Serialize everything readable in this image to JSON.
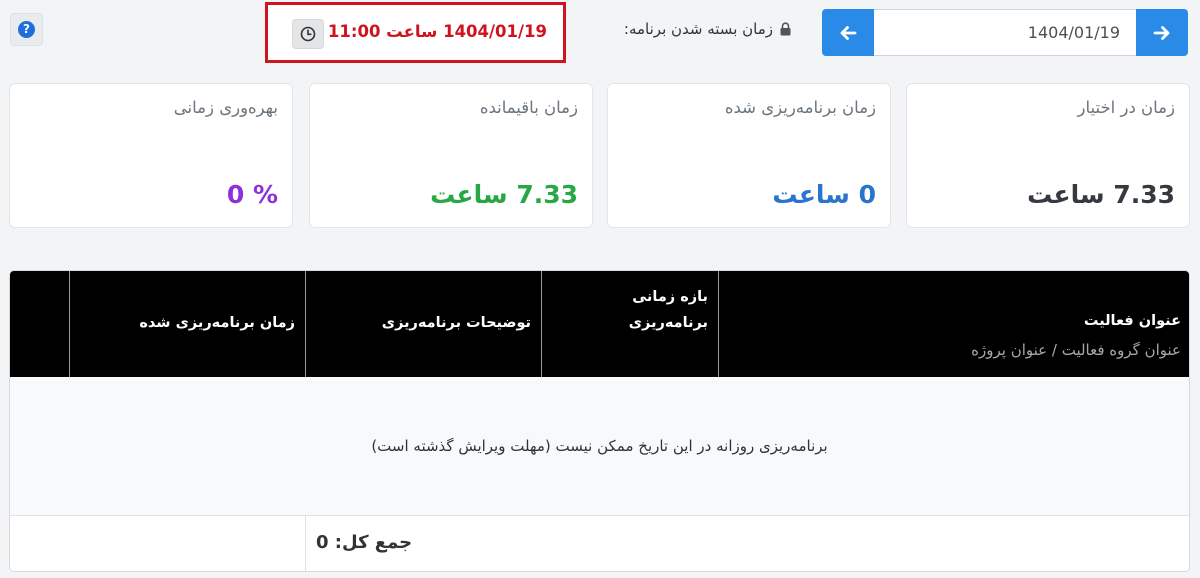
{
  "header": {
    "date_value": "1404/01/19",
    "close_label": "زمان بسته شدن برنامه:",
    "close_time": "1404/01/19 ساعت 11:00",
    "icons": {
      "help": "question-circle-icon",
      "clock": "clock-icon",
      "lock": "lock-icon",
      "prev": "arrow-left-icon",
      "next": "arrow-right-icon"
    },
    "help_glyph": "?"
  },
  "cards": [
    {
      "title": "زمان در اختیار",
      "value": "7.33 ساعت",
      "color": "#343a40"
    },
    {
      "title": "زمان برنامه‌ریزی شده",
      "value": "0 ساعت",
      "color": "#2a73cf"
    },
    {
      "title": "زمان باقیمانده",
      "value": "7.33 ساعت",
      "color": "#28a745"
    },
    {
      "title": "بهره‌وری زمانی",
      "value": "% 0",
      "color": "#8f31d8"
    }
  ],
  "table": {
    "columns": {
      "activity_title": "عنوان فعالیت",
      "activity_sub": "عنوان گروه فعالیت  /  عنوان پروژه",
      "range_line1": "بازه زمانی",
      "range_line2": "برنامه‌ریزی",
      "description": "توضیحات برنامه‌ریزی",
      "planned_time": "زمان برنامه‌ریزی شده"
    },
    "empty_message": "برنامه‌ریزی روزانه در این تاریخ ممکن نیست (مهلت ویرایش گذشته است)",
    "total_label": "جمع کل: 0"
  },
  "colors": {
    "accent": "#2a8ae8",
    "alert": "#d0141f",
    "header_bg": "#000000"
  }
}
